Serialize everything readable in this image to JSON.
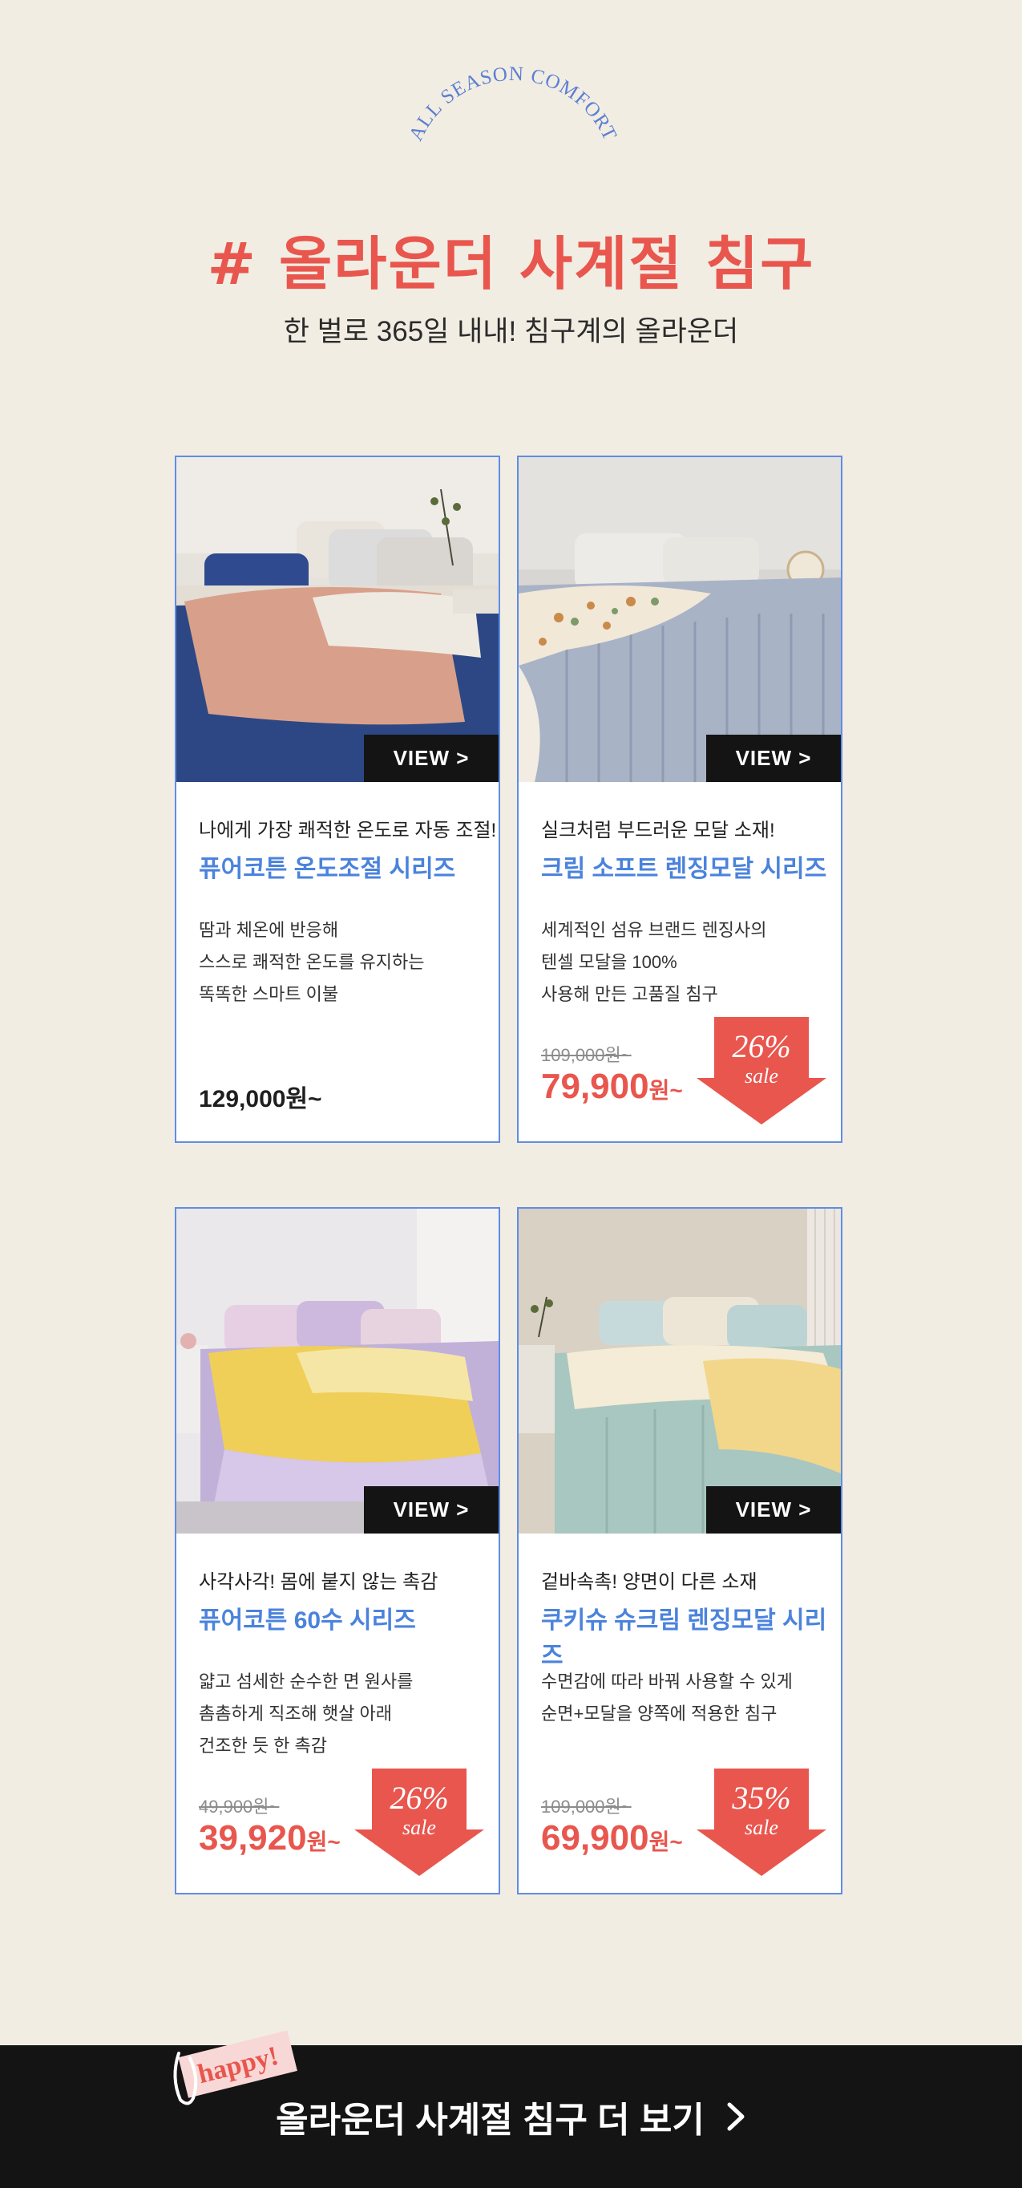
{
  "header": {
    "arc_text": "ALL SEASON COMFORT",
    "title": "# 올라운더 사계절 침구",
    "subtitle": "한 벌로 365일 내내! 침구계의 올라운더"
  },
  "colors": {
    "background": "#f2ede3",
    "accent_red": "#e8564e",
    "accent_blue": "#4b83dc",
    "card_border": "#5f8de5",
    "footer_bg": "#141414"
  },
  "products": [
    {
      "view_label": "VIEW >",
      "tagline": "나에게 가장 쾌적한 온도로 자동 조절!",
      "name": "퓨어코튼 온도조절 시리즈",
      "description": [
        "땀과 체온에 반응해",
        "스스로 쾌적한 온도를 유지하는",
        "똑똑한 스마트 이불"
      ],
      "price": "129,000원~"
    },
    {
      "view_label": "VIEW >",
      "tagline": "실크처럼 부드러운 모달 소재!",
      "name": "크림 소프트 렌징모달 시리즈",
      "description": [
        "세계적인 섬유 브랜드 렌징사의",
        "텐셀 모달을 100%",
        "사용해 만든 고품질 침구"
      ],
      "original_price": "109,000원~",
      "sale_price": "79,900",
      "price_unit": "원~",
      "discount": "26%",
      "sale_label": "sale"
    },
    {
      "view_label": "VIEW >",
      "tagline": "사각사각! 몸에 붙지 않는 촉감",
      "name": "퓨어코튼 60수 시리즈",
      "description": [
        "얇고 섬세한 순수한 면 원사를",
        "촘촘하게 직조해 햇살 아래",
        "건조한 듯 한 촉감"
      ],
      "original_price": "49,900원~",
      "sale_price": "39,920",
      "price_unit": "원~",
      "discount": "26%",
      "sale_label": "sale"
    },
    {
      "view_label": "VIEW >",
      "tagline": "겉바속촉! 양면이 다른 소재",
      "name": "쿠키슈 슈크림 렌징모달 시리즈",
      "description": [
        "수면감에 따라 바꿔 사용할 수 있게",
        "순면+모달을 양쪽에 적용한 침구"
      ],
      "original_price": "109,000원~",
      "sale_price": "69,900",
      "price_unit": "원~",
      "discount": "35%",
      "sale_label": "sale"
    }
  ],
  "footer": {
    "sticker_text": "happy!",
    "cta_label": "올라운더 사계절 침구 더 보기"
  }
}
